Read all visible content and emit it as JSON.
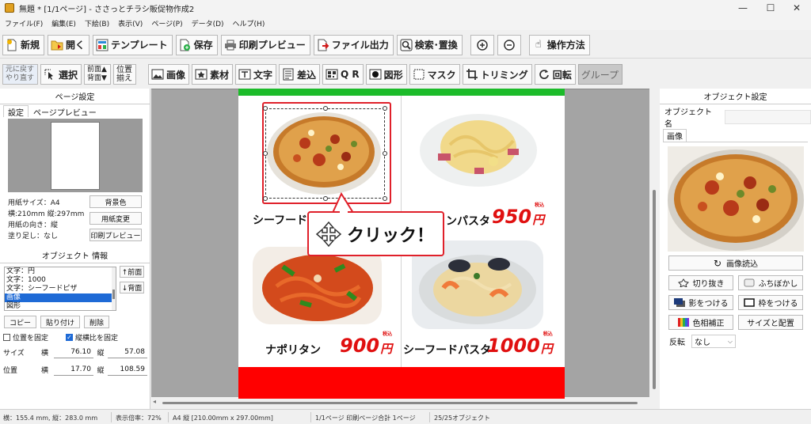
{
  "window": {
    "title": "無題 * [1/1ページ] - ささっとチラシ販促物作成2"
  },
  "menu": [
    "ファイル(F)",
    "編集(E)",
    "下絵(B)",
    "表示(V)",
    "ページ(P)",
    "データ(D)",
    "ヘルプ(H)"
  ],
  "toolbar1": {
    "new": "新規",
    "open": "開く",
    "template": "テンプレート",
    "save": "保存",
    "print_preview": "印刷プレビュー",
    "export": "ファイル出力",
    "search_replace": "検索･置換",
    "help": "操作方法"
  },
  "toolbar2": {
    "undo": "元に戻す",
    "redo": "やり直す",
    "select": "選択",
    "front": "前面▲",
    "back": "背面▼",
    "align_top": "位置",
    "align_bottom": "揃え",
    "image": "画像",
    "material": "素材",
    "text": "文字",
    "merge": "差込",
    "qr": "Q R",
    "shape": "図形",
    "mask": "マスク",
    "trimming": "トリミング",
    "rotate": "回転",
    "group": "グループ"
  },
  "page_settings": {
    "header": "ページ設定",
    "tab_settings": "設定",
    "tab_preview": "ページプレビュー",
    "paper_size": "用紙サイズ：A4",
    "dimensions": "横:210mm 縦:297mm",
    "orientation": "用紙の向き：縦",
    "bleed": "塗り足し：なし",
    "bg_color_btn": "背景色",
    "change_paper_btn": "用紙変更",
    "print_preview_btn": "印刷プレビュー"
  },
  "object_info": {
    "header": "オブジェクト 情報",
    "items": [
      "文字：円",
      "文字：1000",
      "文字：シーフードピザ",
      "画像",
      "図形"
    ],
    "selected_index": 3,
    "front_btn": "↑前面",
    "back_btn": "↓背面",
    "copy_btn": "コピー",
    "paste_btn": "貼り付け",
    "delete_btn": "削除",
    "fix_position": "位置を固定",
    "fix_position_checked": false,
    "keep_ratio": "縦横比を固定",
    "keep_ratio_checked": true,
    "size_label": "サイズ",
    "position_label": "位置",
    "w_label": "横",
    "h_label": "縦",
    "size_w": "76.10",
    "size_h": "57.08",
    "pos_x": "17.70",
    "pos_y": "108.59"
  },
  "flyer": {
    "items": [
      {
        "name": "シーフードピザ",
        "price": "",
        "food": "pizza"
      },
      {
        "name": "ンパスタ",
        "price": "950",
        "food": "carbonara"
      },
      {
        "name": "ナポリタン",
        "price": "900",
        "food": "napolitan"
      },
      {
        "name": "シーフードパスタ",
        "price": "1000",
        "food": "seafood"
      }
    ],
    "yen": "円",
    "tax": "税込",
    "colors": {
      "top_band": "#1cbb2a",
      "bottom_band": "#ff0000",
      "price": "#e01010"
    }
  },
  "callout": {
    "text": "クリック！"
  },
  "object_settings": {
    "header": "オブジェクト設定",
    "name_label": "オブジェクト名",
    "name_value": "",
    "tab": "画像",
    "load_image": "画像読込",
    "crop": "切り抜き",
    "blur_edge": "ふちぼかし",
    "shadow": "影をつける",
    "frame": "枠をつける",
    "color_correct": "色相補正",
    "size_position": "サイズと配置",
    "flip_label": "反転",
    "flip_value": "なし"
  },
  "status": {
    "cursor": "横：155.4 mm, 縦：283.0 mm",
    "zoom": "表示倍率：72%",
    "paper": "A4 縦 [210.00mm x 297.00mm]",
    "pages": "1/1ページ 印刷ページ合計 1ページ",
    "objects": "25/25オブジェクト"
  }
}
